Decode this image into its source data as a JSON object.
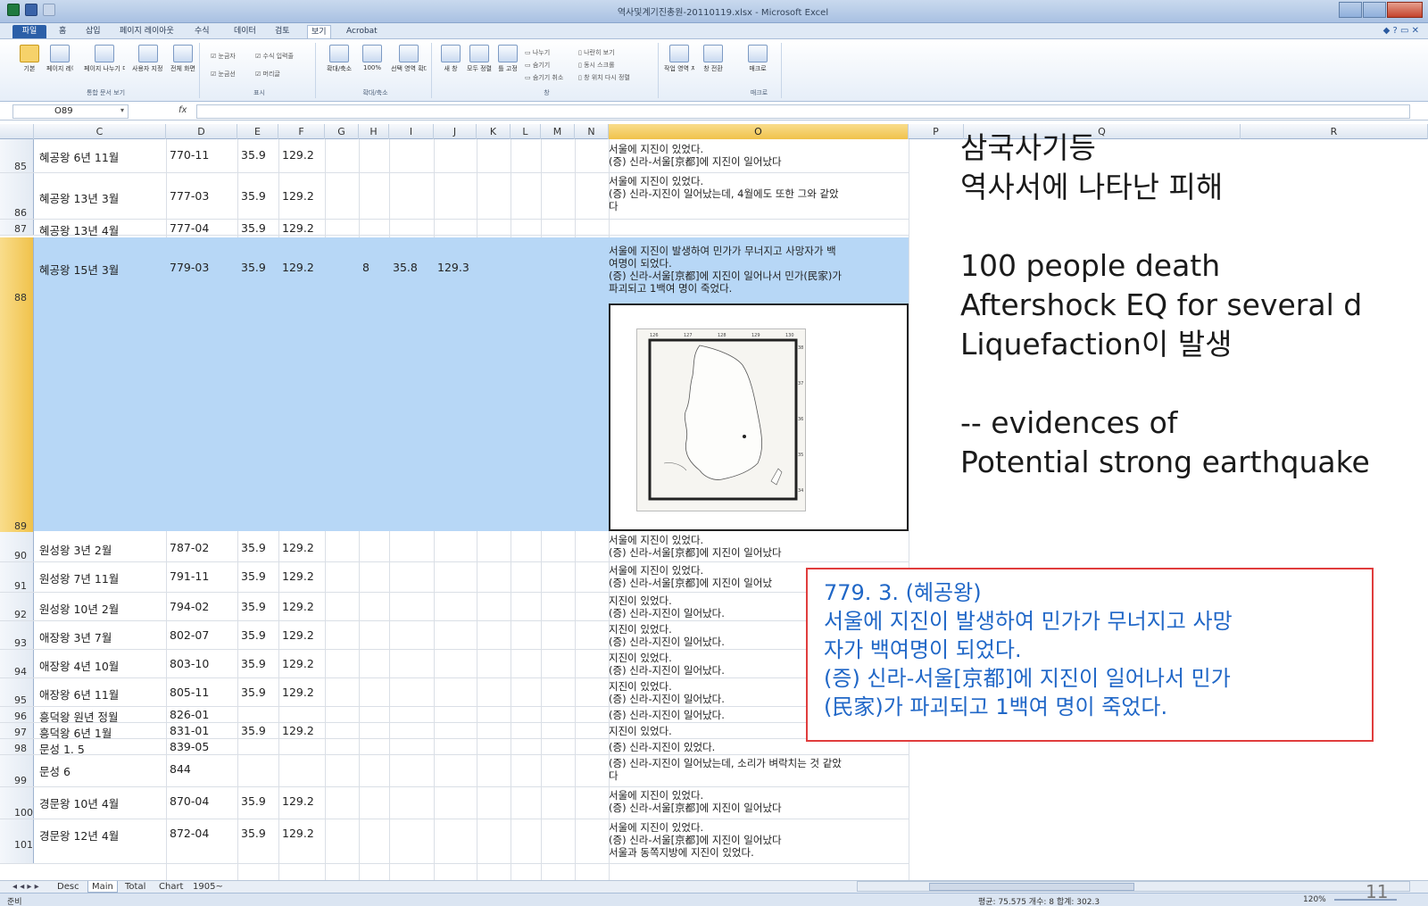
{
  "window": {
    "title": "역사및계기진총원-20110119.xlsx - Microsoft Excel",
    "icons": [
      "excel-app-icon",
      "save-icon",
      "undo-icon",
      "minimize-icon",
      "maximize-icon",
      "close-icon"
    ]
  },
  "ribbon": {
    "tabs": [
      "파일",
      "홈",
      "삽입",
      "페이지 레이아웃",
      "수식",
      "데이터",
      "검토",
      "보기",
      "Acrobat"
    ],
    "active_tab": "보기",
    "groups": [
      {
        "label": "통합 문서 보기",
        "buttons": [
          "기본",
          "페이지 레이아웃",
          "페이지 나누기 미리 보기",
          "사용자 지정 보기",
          "전체 화면"
        ]
      },
      {
        "label": "표시",
        "options": [
          "눈금자",
          "수식 입력줄",
          "눈금선",
          "머리글"
        ]
      },
      {
        "label": "확대/축소",
        "buttons": [
          "확대/축소",
          "100%",
          "선택 영역 확대/축소"
        ]
      },
      {
        "label": "창",
        "buttons": [
          "새 창",
          "모두 정렬",
          "틀 고정",
          "나누기",
          "숨기기",
          "숨기기 취소",
          "나란히 보기",
          "동시 스크롤",
          "창 위치 다시 정렬",
          "작업 영역 저장",
          "창 전환"
        ]
      },
      {
        "label": "매크로",
        "buttons": [
          "매크로"
        ]
      }
    ]
  },
  "formula_bar": {
    "name_box": "O89",
    "fx": "fx",
    "content": ""
  },
  "columns": [
    "C",
    "D",
    "E",
    "F",
    "G",
    "H",
    "I",
    "J",
    "K",
    "L",
    "M",
    "N",
    "O",
    "P",
    "Q",
    "R"
  ],
  "rows": [
    {
      "num": "85",
      "c": "혜공왕 6년 11월",
      "d": "770-11",
      "e": "35.9",
      "f": "129.2",
      "o": [
        "서울에 지진이 있었다.",
        "(증) 신라-서울[京都]에 지진이 일어났다"
      ]
    },
    {
      "num": "86",
      "c": "혜공왕 13년 3월",
      "d": "777-03",
      "e": "35.9",
      "f": "129.2",
      "o": [
        "서울에 지진이 있었다.",
        "(증) 신라-지진이 일어났는데, 4월에도 또한 그와 같았",
        "다"
      ]
    },
    {
      "num": "87",
      "c": "혜공왕 13년 4월",
      "d": "777-04",
      "e": "35.9",
      "f": "129.2",
      "o": []
    },
    {
      "num": "88",
      "c": "혜공왕 15년 3월",
      "d": "779-03",
      "e": "35.9",
      "f": "129.2",
      "h": "8",
      "i": "35.8",
      "j": "129.3",
      "o": [
        "서울에 지진이 발생하여 민가가 무너지고 사망자가 백",
        "여명이 되었다.",
        "(증) 신라-서울[京都]에 지진이 일어나서 민가(民家)가",
        "파괴되고 1백여 명이 죽었다."
      ]
    },
    {
      "num": "89",
      "c": "",
      "d": "",
      "e": "",
      "f": "",
      "o": []
    },
    {
      "num": "90",
      "c": "원성왕 3년 2월",
      "d": "787-02",
      "e": "35.9",
      "f": "129.2",
      "o": [
        "서울에 지진이 있었다.",
        "(증) 신라-서울[京都]에 지진이 일어났다"
      ]
    },
    {
      "num": "91",
      "c": "원성왕 7년 11월",
      "d": "791-11",
      "e": "35.9",
      "f": "129.2",
      "o": [
        "서울에 지진이 있었다.",
        "(증) 신라-서울[京都]에 지진이 일어났"
      ]
    },
    {
      "num": "92",
      "c": "원성왕 10년 2월",
      "d": "794-02",
      "e": "35.9",
      "f": "129.2",
      "o": [
        "지진이 있었다.",
        "(증) 신라-지진이 일어났다."
      ]
    },
    {
      "num": "93",
      "c": "애장왕 3년 7월",
      "d": "802-07",
      "e": "35.9",
      "f": "129.2",
      "o": [
        "지진이 있었다.",
        "(증) 신라-지진이 일어났다."
      ]
    },
    {
      "num": "94",
      "c": "애장왕 4년 10월",
      "d": "803-10",
      "e": "35.9",
      "f": "129.2",
      "o": [
        "지진이 있었다.",
        "(증) 신라-지진이 일어났다."
      ]
    },
    {
      "num": "95",
      "c": "애장왕 6년 11월",
      "d": "805-11",
      "e": "35.9",
      "f": "129.2",
      "o": [
        "지진이 있었다.",
        "(증) 신라-지진이 일어났다."
      ]
    },
    {
      "num": "96",
      "c": "흥덕왕 원년 정월",
      "d": "826-01",
      "e": "",
      "f": "",
      "o": [
        "(증) 신라-지진이 일어났다."
      ]
    },
    {
      "num": "97",
      "c": "흥덕왕 6년 1월",
      "d": "831-01",
      "e": "35.9",
      "f": "129.2",
      "o": [
        "지진이 있었다."
      ]
    },
    {
      "num": "98",
      "c": "문성 1. 5",
      "d": "839-05",
      "e": "",
      "f": "",
      "o": [
        "(증) 신라-지진이 있었다."
      ]
    },
    {
      "num": "99",
      "c": "문성 6",
      "d": "844",
      "e": "",
      "f": "",
      "o": [
        "(증) 신라-지진이 일어났는데, 소리가 벼락치는 것 같았",
        "다"
      ]
    },
    {
      "num": "100",
      "c": "경문왕 10년 4월",
      "d": "870-04",
      "e": "35.9",
      "f": "129.2",
      "o": [
        "서울에 지진이 있었다.",
        "(증) 신라-서울[京都]에 지진이 일어났다"
      ]
    },
    {
      "num": "101",
      "c": "경문왕 12년 4월",
      "d": "872-04",
      "e": "35.9",
      "f": "129.2",
      "o": [
        "서울에 지진이 있었다.",
        "(증) 신라-서울[京都]에 지진이 일어났다",
        "서울과 동쪽지방에 지진이 있었다."
      ]
    }
  ],
  "map_ticks": {
    "top": [
      "126",
      "127",
      "128",
      "129",
      "130"
    ],
    "right": [
      "38",
      "37",
      "36",
      "35",
      "34"
    ]
  },
  "overlay": {
    "lines": [
      "삼국사기등",
      "역사서에 나타난 피해",
      "",
      "100 people death",
      "Aftershock EQ for several d",
      "Liquefaction이 발생",
      "",
      "-- evidences of",
      "Potential strong earthquake"
    ]
  },
  "callout": {
    "lines": [
      "779. 3. (혜공왕)",
      "서울에 지진이 발생하여 민가가 무너지고 사망",
      "자가 백여명이 되었다.",
      "(증) 신라-서울[京都]에 지진이 일어나서 민가",
      "(民家)가 파괴되고 1백여 명이 죽었다."
    ],
    "border_color": "#e03d3d",
    "text_color": "#2067c7"
  },
  "sheet_tabs": [
    "Desc",
    "Main",
    "Total",
    "Chart",
    "1905~"
  ],
  "active_sheet": "Main",
  "status": {
    "ready": "준비",
    "stats": "평균: 75.575   개수: 8   합계: 302.3",
    "zoom": "120%",
    "page_number": "11"
  }
}
